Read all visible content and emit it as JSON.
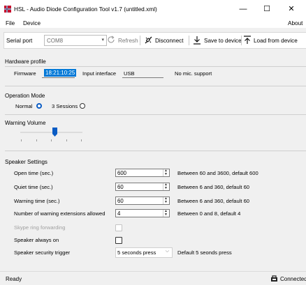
{
  "window": {
    "title": "HSL - Audio Diode Configuration Tool v1.7 (untitled.xml)",
    "minimize": "—",
    "maximize": "☐",
    "close": "✕"
  },
  "menu": {
    "file": "File",
    "device": "Device",
    "about": "About"
  },
  "toolbar": {
    "serial_port_label": "Serial port",
    "serial_port_value": "COM8",
    "refresh": "Refresh",
    "disconnect": "Disconnect",
    "save": "Save to device",
    "load": "Load from device"
  },
  "hardware": {
    "title": "Hardware profile",
    "firmware_label": "Firmware",
    "firmware_value": "18:21:10:25",
    "input_label": "Input interface",
    "input_value": "USB",
    "mic_support": "No mic. support"
  },
  "mode": {
    "title": "Operation Mode",
    "normal": "Normal",
    "three_sessions": "3 Sessions",
    "selected": "normal"
  },
  "volume": {
    "title": "Warning Volume",
    "level": 0.55
  },
  "speaker": {
    "title": "Speaker Settings",
    "rows": [
      {
        "label": "Open time (sec.)",
        "value": "600",
        "hint": "Between 60 and 3600, default 600"
      },
      {
        "label": "Quiet time (sec.)",
        "value": "60",
        "hint": "Between 6 and 360, default 60"
      },
      {
        "label": "Warning time (sec.)",
        "value": "60",
        "hint": "Between 6 and 360, default 60"
      },
      {
        "label": "Number of warning extensions allowed",
        "value": "4",
        "hint": "Between 0 and 8, default 4"
      }
    ],
    "skype_label": "Skype ring forwarding",
    "always_on_label": "Speaker always on",
    "trigger_label": "Speaker security trigger",
    "trigger_value": "5 seconds press",
    "trigger_hint": "Default 5 seonds press"
  },
  "status": {
    "left": "Ready",
    "right": "Connected"
  },
  "colors": {
    "accent": "#0a5cc4",
    "selection": "#0078d7",
    "app_icon": "#c8102e"
  },
  "icons": [
    "app-flag-icon",
    "refresh-icon",
    "disconnect-icon",
    "save-download-icon",
    "load-upload-icon",
    "connected-icon"
  ]
}
